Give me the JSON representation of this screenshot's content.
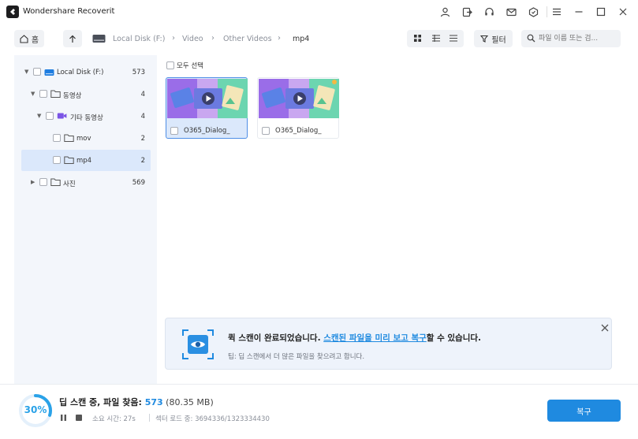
{
  "app": {
    "title": "Wondershare Recoverit"
  },
  "nav": {
    "home_label": "홈",
    "breadcrumbs": [
      "Local Disk (F:)",
      "Video",
      "Other Videos",
      "mp4"
    ],
    "filter_label": "필터",
    "search_placeholder": "파일 이름 또는 검..."
  },
  "sidebar": {
    "items": [
      {
        "label": "Local Disk (F:)",
        "count": "573",
        "icon": "drive-icon",
        "expanded": true
      },
      {
        "label": "동영상",
        "count": "4",
        "icon": "folder-icon",
        "expanded": true
      },
      {
        "label": "기타 동영상",
        "count": "4",
        "icon": "video-folder-icon",
        "expanded": true
      },
      {
        "label": "mov",
        "count": "2",
        "icon": "folder-icon"
      },
      {
        "label": "mp4",
        "count": "2",
        "icon": "folder-icon",
        "selected": true
      },
      {
        "label": "사진",
        "count": "569",
        "icon": "folder-icon",
        "expanded": false
      }
    ]
  },
  "content": {
    "select_all_label": "모두 선택",
    "files": [
      {
        "name": "O365_Dialog_",
        "selected": true
      },
      {
        "name": "O365_Dialog_",
        "selected": false
      }
    ]
  },
  "notice": {
    "text_before": "퀵 스캔이 완료되었습니다. ",
    "link_text": "스캔된 파일을 미리 보고 복구",
    "text_after": "할 수 있습니다.",
    "tip": "팁: 딥 스캔에서 더 많은 파일을 찾으려고 합니다."
  },
  "status": {
    "progress": "30%",
    "progress_value": 30,
    "scan_label": "딥 스캔 중, 파일 찾음: ",
    "found_count": "573",
    "found_size": " (80.35 MB)",
    "elapsed": "소요 시간: 27s",
    "sectors": "섹터 로드 중: 3694336/1323334430",
    "recover_label": "복구"
  },
  "colors": {
    "accent": "#1f8ae0",
    "sidebar_bg": "#f3f6fb",
    "selected_bg": "#dbe8fb",
    "progress": "#2aa2e8"
  }
}
